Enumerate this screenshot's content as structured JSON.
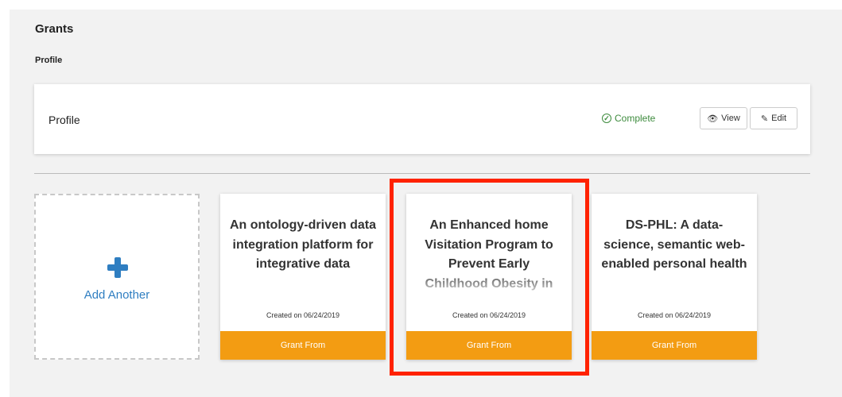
{
  "header": {
    "title": "Grants",
    "subtitle": "Profile"
  },
  "profile": {
    "label": "Profile",
    "status": "Complete",
    "status_color": "#3d8b3d",
    "view_label": "View",
    "edit_label": "Edit"
  },
  "add_card": {
    "label": "Add Another",
    "accent": "#2f7ec1"
  },
  "grants": [
    {
      "title": "An ontology-driven data integration platform for integrative data",
      "created": "Created on 06/24/2019",
      "button": "Grant From"
    },
    {
      "title": "An Enhanced home Visitation Program to Prevent Early Childhood Obesity in",
      "created": "Created on 06/24/2019",
      "button": "Grant From"
    },
    {
      "title": "DS-PHL: A data-science, semantic web-enabled personal health",
      "created": "Created on 06/24/2019",
      "button": "Grant From"
    }
  ],
  "colors": {
    "grant_button": "#f39c12",
    "highlight": "#ff2200"
  }
}
